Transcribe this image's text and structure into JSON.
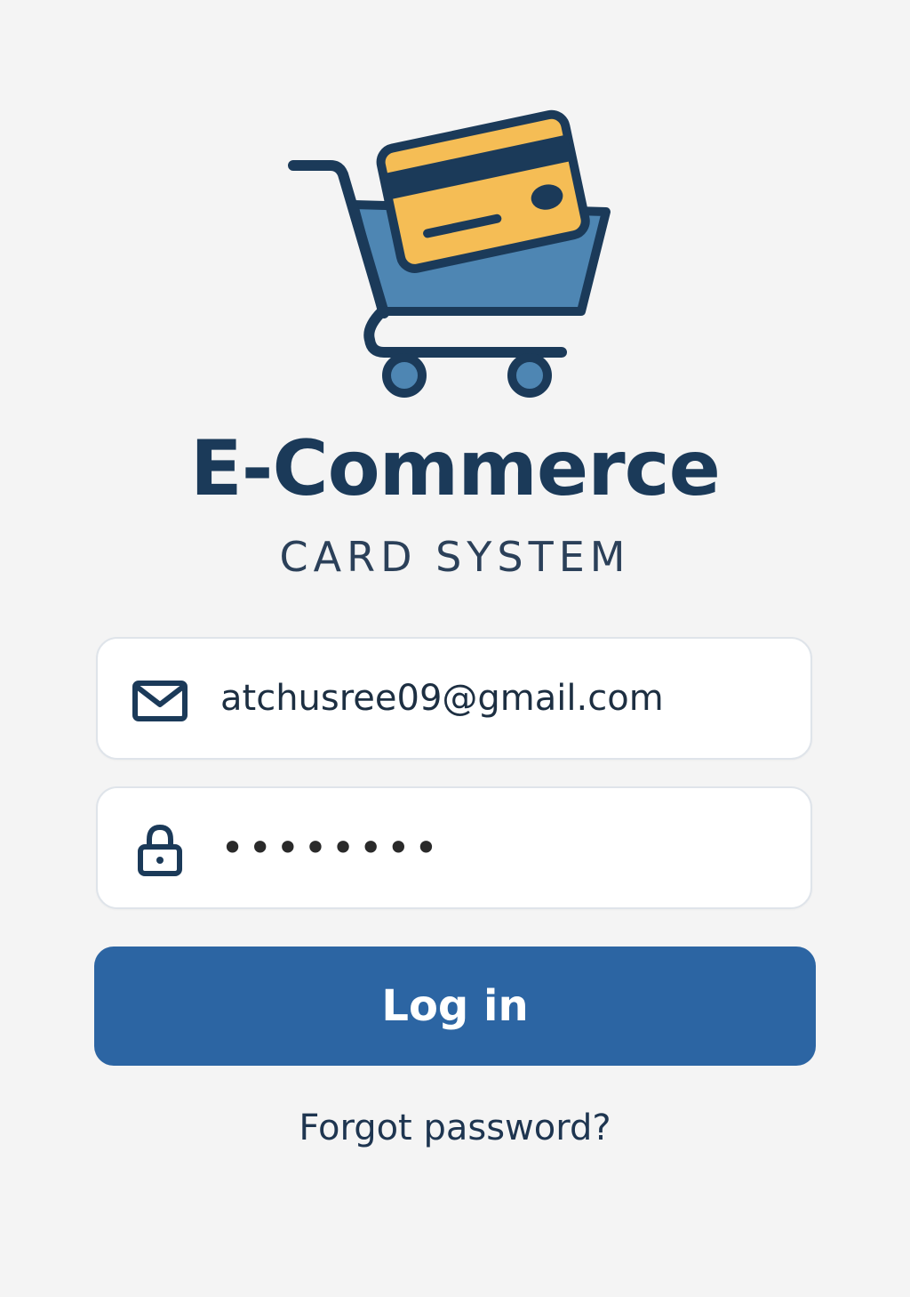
{
  "brand": {
    "title": "E-Commerce",
    "subtitle": "CARD SYSTEM",
    "logo_icon": "shopping-cart-with-credit-card-icon"
  },
  "colors": {
    "background": "#f4f4f4",
    "brand_navy": "#1b3a59",
    "cart_blue": "#4e86b3",
    "card_yellow": "#f5bd55",
    "button_blue": "#2c65a3",
    "field_border": "#dfe4ea"
  },
  "login_form": {
    "email": {
      "icon": "envelope-icon",
      "value": "atchusree09@gmail.com"
    },
    "password": {
      "icon": "lock-icon",
      "value": "••••••••"
    },
    "submit_label": "Log in",
    "forgot_label": "Forgot password?"
  }
}
